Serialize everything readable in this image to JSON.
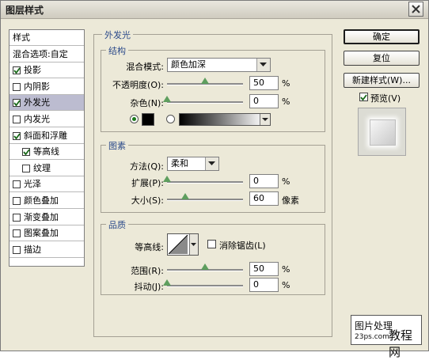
{
  "window": {
    "title": "图层样式"
  },
  "left_list": [
    {
      "label": "样式",
      "checkbox": false,
      "checked": false,
      "selected": false,
      "indent": 0
    },
    {
      "label": "混合选项:自定",
      "checkbox": false,
      "checked": false,
      "selected": false,
      "indent": 0
    },
    {
      "label": "投影",
      "checkbox": true,
      "checked": true,
      "selected": false,
      "indent": 0
    },
    {
      "label": "内阴影",
      "checkbox": true,
      "checked": false,
      "selected": false,
      "indent": 0
    },
    {
      "label": "外发光",
      "checkbox": true,
      "checked": true,
      "selected": true,
      "indent": 0
    },
    {
      "label": "内发光",
      "checkbox": true,
      "checked": false,
      "selected": false,
      "indent": 0
    },
    {
      "label": "斜面和浮雕",
      "checkbox": true,
      "checked": true,
      "selected": false,
      "indent": 0
    },
    {
      "label": "等高线",
      "checkbox": true,
      "checked": true,
      "selected": false,
      "indent": 1
    },
    {
      "label": "纹理",
      "checkbox": true,
      "checked": false,
      "selected": false,
      "indent": 1
    },
    {
      "label": "光泽",
      "checkbox": true,
      "checked": false,
      "selected": false,
      "indent": 0
    },
    {
      "label": "颜色叠加",
      "checkbox": true,
      "checked": false,
      "selected": false,
      "indent": 0
    },
    {
      "label": "渐变叠加",
      "checkbox": true,
      "checked": false,
      "selected": false,
      "indent": 0
    },
    {
      "label": "图案叠加",
      "checkbox": true,
      "checked": false,
      "selected": false,
      "indent": 0
    },
    {
      "label": "描边",
      "checkbox": true,
      "checked": false,
      "selected": false,
      "indent": 0
    }
  ],
  "outer_glow": {
    "section_title": "外发光",
    "structure": {
      "title": "结构",
      "blend_mode_label": "混合模式:",
      "blend_mode_value": "颜色加深",
      "opacity_label": "不透明度(O):",
      "opacity_value": "50",
      "opacity_level": 0.5,
      "noise_label": "杂色(N):",
      "noise_value": "0",
      "noise_level": 0
    },
    "elements": {
      "title": "图素",
      "method_label": "方法(Q):",
      "method_value": "柔和",
      "spread_label": "扩展(P):",
      "spread_value": "0",
      "spread_level": 0,
      "size_label": "大小(S):",
      "size_value": "60",
      "size_unit": "像素",
      "size_level": 0.24
    },
    "quality": {
      "title": "品质",
      "contour_label": "等高线:",
      "antialias_label": "消除锯齿(L)",
      "range_label": "范围(R):",
      "range_value": "50",
      "range_level": 0.5,
      "jitter_label": "抖动(J):",
      "jitter_value": "0",
      "jitter_level": 0
    },
    "percent": "%"
  },
  "buttons": {
    "ok": "确定",
    "reset": "复位",
    "new_style": "新建样式(W)...",
    "preview": "预览(V)"
  },
  "watermark": {
    "line1": "图片处理",
    "line2": "23ps.com",
    "line3": "教程网"
  },
  "colors": {
    "selected_row": "#bcbcd0",
    "slider_thumb": "#5e9e5e",
    "group_title": "#2b4a8a",
    "glow_color": "#000000"
  }
}
